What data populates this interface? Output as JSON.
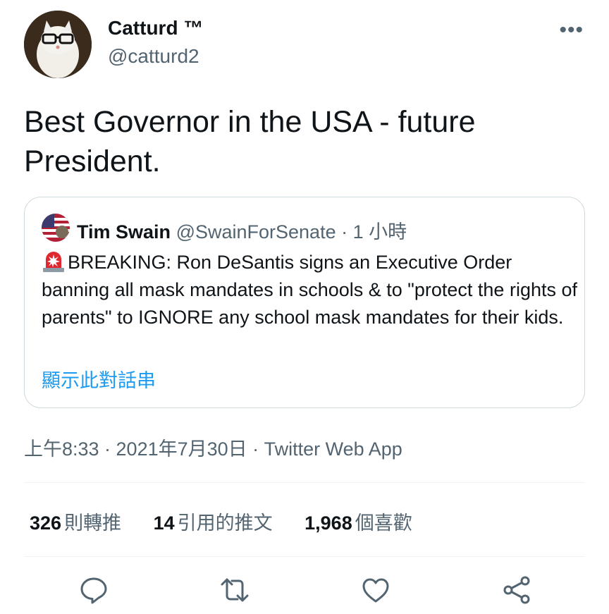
{
  "author": {
    "name": "Catturd ™",
    "handle": "@catturd2"
  },
  "more_label": "•••",
  "tweet": {
    "text_line1": "Best Governor in the USA -  future",
    "text_line2": "President."
  },
  "quoted_tweet": {
    "name": "Tim Swain",
    "handle": "@SwainForSenate",
    "separator": " · ",
    "time": "1 小時",
    "icon": "rotating-light-emoji",
    "text": "BREAKING: Ron DeSantis signs an Executive Order banning all mask mandates in schools & to \"protect the rights of parents\" to IGNORE any school mask mandates for their kids.",
    "show_thread": "顯示此對話串"
  },
  "meta": {
    "timestamp": "上午8:33 · 2021年7月30日 · Twitter Web App"
  },
  "stats": [
    {
      "count": "326",
      "label": "則轉推"
    },
    {
      "count": "14",
      "label": "引用的推文"
    },
    {
      "count": "1,968",
      "label": "個喜歡"
    }
  ],
  "actions": [
    {
      "name": "reply",
      "icon": "reply-icon"
    },
    {
      "name": "retweet",
      "icon": "retweet-icon"
    },
    {
      "name": "like",
      "icon": "heart-icon"
    },
    {
      "name": "share",
      "icon": "share-icon"
    }
  ],
  "colors": {
    "text": "#0f1419",
    "secondary": "#536471",
    "link": "#1d9bf0",
    "border": "#cfd9de",
    "icon": "#536471"
  }
}
